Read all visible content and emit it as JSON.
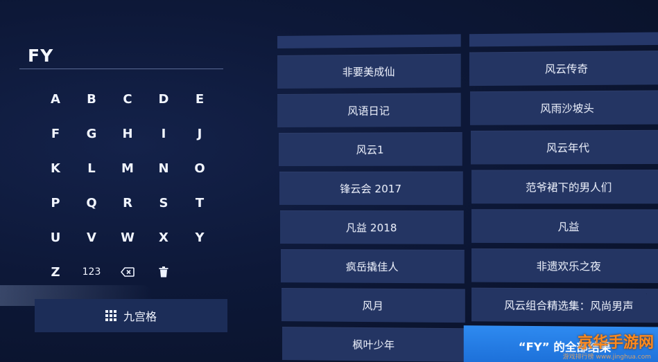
{
  "search": {
    "query": "FY"
  },
  "keyboard": {
    "letters": [
      "A",
      "B",
      "C",
      "D",
      "E",
      "F",
      "G",
      "H",
      "I",
      "J",
      "K",
      "L",
      "M",
      "N",
      "O",
      "P",
      "Q",
      "R",
      "S",
      "T",
      "U",
      "V",
      "W",
      "X",
      "Y",
      "Z"
    ],
    "numbers_key": "123",
    "backspace_icon": "backspace-icon",
    "delete_icon": "trash-icon"
  },
  "nine_grid": {
    "label": "九宫格",
    "icon": "grid-icon"
  },
  "results": {
    "left_column": [
      "非要美成仙",
      "风语日记",
      "风云1",
      "锋云会 2017",
      "凡益 2018",
      "疯岳撬佳人",
      "风月",
      "枫叶少年"
    ],
    "right_column": [
      "风云传奇",
      "风雨沙坡头",
      "风云年代",
      "范爷裙下的男人们",
      "凡益",
      "非遗欢乐之夜",
      "风云组合精选集：风尚男声"
    ],
    "all_results_label": "“FY” 的全部结果"
  },
  "colors": {
    "highlight": "#2e8af0",
    "tile": "#243563",
    "background": "#0b1430"
  },
  "watermark": {
    "text": "京华手游网",
    "sub": "游戏排行榜 www.jinghua.com"
  }
}
